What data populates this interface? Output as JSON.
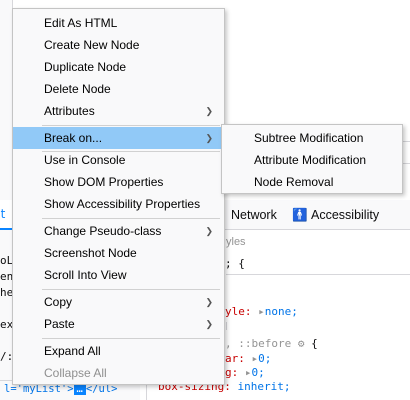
{
  "background": {
    "tabs": [
      {
        "label": "Network"
      },
      {
        "label": "Accessibility",
        "icon": "accessibility-icon"
      }
    ],
    "left_tab_fragment": "ct",
    "styles_fragments": {
      "header": "yles",
      "brace_open": "; {",
      "style_prop": "yle:",
      "style_value": "none;",
      "pseudo": ", ::before",
      "brace_open2": "{",
      "margin_prop": "ar:",
      "zero1": "0;",
      "zero2": "0;",
      "box_sizing_prop": "box-sizing:",
      "box_sizing_value": "inherit;"
    },
    "markup_fragments": [
      "oL:",
      "ent",
      "he",
      "ex",
      "/:"
    ],
    "breadcrumb": {
      "prefix": "l='myList'>",
      "selected": "…",
      "suffix": "</ul>"
    }
  },
  "menu": {
    "items": [
      {
        "label": "Edit As HTML",
        "has_submenu": false,
        "enabled": true
      },
      {
        "label": "Create New Node",
        "has_submenu": false,
        "enabled": true
      },
      {
        "label": "Duplicate Node",
        "has_submenu": false,
        "enabled": true
      },
      {
        "label": "Delete Node",
        "has_submenu": false,
        "enabled": true
      },
      {
        "label": "Attributes",
        "has_submenu": true,
        "enabled": true
      },
      {
        "label": "Break on...",
        "has_submenu": true,
        "enabled": true,
        "highlighted": true
      },
      {
        "label": "Use in Console",
        "has_submenu": false,
        "enabled": true
      },
      {
        "label": "Show DOM Properties",
        "has_submenu": false,
        "enabled": true
      },
      {
        "label": "Show Accessibility Properties",
        "has_submenu": false,
        "enabled": true
      },
      {
        "label": "Change Pseudo-class",
        "has_submenu": true,
        "enabled": true
      },
      {
        "label": "Screenshot Node",
        "has_submenu": false,
        "enabled": true
      },
      {
        "label": "Scroll Into View",
        "has_submenu": false,
        "enabled": true
      },
      {
        "label": "Copy",
        "has_submenu": true,
        "enabled": true
      },
      {
        "label": "Paste",
        "has_submenu": true,
        "enabled": true
      },
      {
        "label": "Expand All",
        "has_submenu": false,
        "enabled": true
      },
      {
        "label": "Collapse All",
        "has_submenu": false,
        "enabled": false
      }
    ]
  },
  "submenu": {
    "items": [
      {
        "label": "Subtree Modification"
      },
      {
        "label": "Attribute Modification"
      },
      {
        "label": "Node Removal"
      }
    ]
  },
  "colors": {
    "highlight": "#91c9f7",
    "accent": "#0a84ff",
    "accessibility_icon": "#12bc00"
  }
}
